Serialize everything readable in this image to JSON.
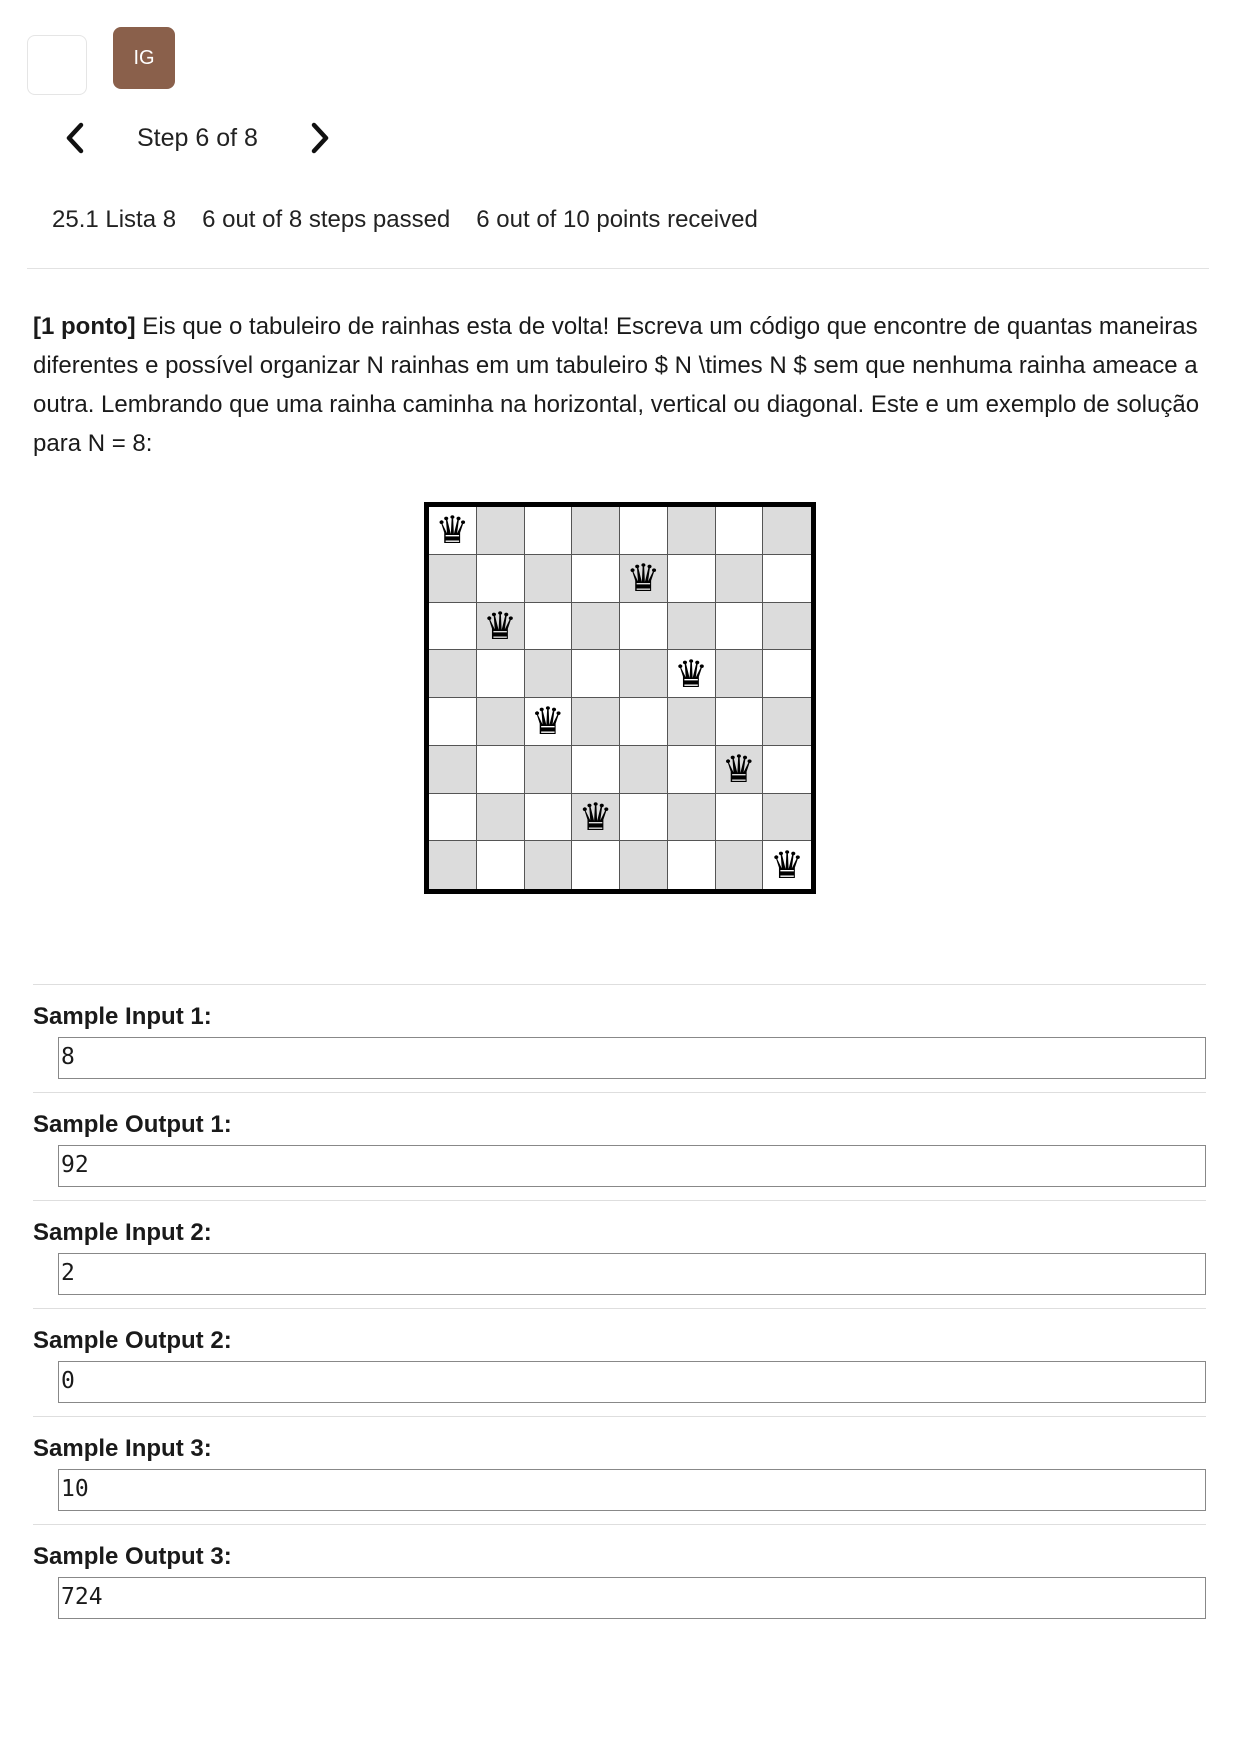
{
  "header": {
    "avatar_initials": "IG",
    "avatar_color": "#8a604b"
  },
  "step_nav": {
    "label": "Step 6 of 8",
    "prev_icon": "chevron-left-icon",
    "next_icon": "chevron-right-icon"
  },
  "progress": {
    "lesson": "25.1 Lista 8",
    "steps": "6 out of 8 steps passed",
    "points": "6 out of 10 points received"
  },
  "statement": {
    "points_tag": "[1 ponto]",
    "text": " Eis que o tabuleiro de rainhas esta de volta! Escreva um código que encontre de quantas maneiras diferentes e possível organizar N rainhas em um tabuleiro $ N \\times N $ sem que nenhuma rainha ameace a outra. Lembrando que uma rainha caminha na horizontal, vertical ou diagonal. Este e um exemplo de solução para N = 8:"
  },
  "board": {
    "size": 8,
    "queen_glyph": "♛",
    "queen_columns_by_row": [
      0,
      4,
      1,
      5,
      2,
      6,
      3,
      7
    ],
    "dark_color": "#dcdcdc"
  },
  "samples": [
    {
      "label": "Sample Input 1:",
      "value": "8"
    },
    {
      "label": "Sample Output 1:",
      "value": "92"
    },
    {
      "label": "Sample Input 2:",
      "value": "2"
    },
    {
      "label": "Sample Output 2:",
      "value": "0"
    },
    {
      "label": "Sample Input 3:",
      "value": "10"
    },
    {
      "label": "Sample Output 3:",
      "value": "724"
    }
  ]
}
